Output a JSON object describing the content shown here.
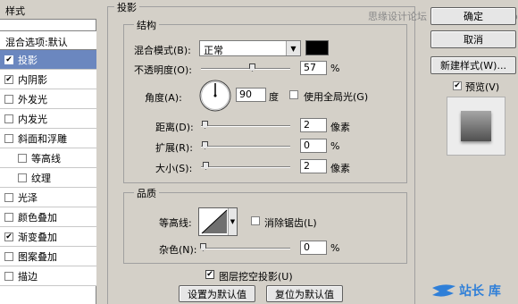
{
  "left_panel": {
    "header": "样式",
    "blend_options": "混合选项:默认",
    "items": [
      {
        "label": "投影",
        "checked": true,
        "selected": true,
        "sub": false
      },
      {
        "label": "内阴影",
        "checked": true,
        "selected": false,
        "sub": false
      },
      {
        "label": "外发光",
        "checked": false,
        "selected": false,
        "sub": false
      },
      {
        "label": "内发光",
        "checked": false,
        "selected": false,
        "sub": false
      },
      {
        "label": "斜面和浮雕",
        "checked": false,
        "selected": false,
        "sub": false
      },
      {
        "label": "等高线",
        "checked": false,
        "selected": false,
        "sub": true
      },
      {
        "label": "纹理",
        "checked": false,
        "selected": false,
        "sub": true
      },
      {
        "label": "光泽",
        "checked": false,
        "selected": false,
        "sub": false
      },
      {
        "label": "颜色叠加",
        "checked": false,
        "selected": false,
        "sub": false
      },
      {
        "label": "渐变叠加",
        "checked": true,
        "selected": false,
        "sub": false
      },
      {
        "label": "图案叠加",
        "checked": false,
        "selected": false,
        "sub": false
      },
      {
        "label": "描边",
        "checked": false,
        "selected": false,
        "sub": false
      }
    ]
  },
  "drop_shadow": {
    "title": "投影",
    "structure": {
      "title": "结构",
      "blend_mode_label": "混合模式(B):",
      "blend_mode_value": "正常",
      "blend_color": "#000000",
      "opacity_label": "不透明度(O):",
      "opacity_value": "57",
      "opacity_level": 0.57,
      "opacity_unit": "%",
      "angle_label": "角度(A):",
      "angle_value": "90",
      "angle_unit": "度",
      "global_light_label": "使用全局光(G)",
      "global_light_checked": false,
      "distance_label": "距离(D):",
      "distance_value": "2",
      "distance_unit": "像素",
      "spread_label": "扩展(R):",
      "spread_value": "0",
      "spread_unit": "%",
      "size_label": "大小(S):",
      "size_value": "2",
      "size_unit": "像素"
    },
    "quality": {
      "title": "品质",
      "contour_label": "等高线:",
      "anti_alias_label": "消除锯齿(L)",
      "anti_alias_checked": false,
      "noise_label": "杂色(N):",
      "noise_value": "0",
      "noise_unit": "%"
    },
    "knockout_label": "图层挖空投影(U)",
    "knockout_checked": true,
    "make_default_label": "设置为默认值",
    "reset_default_label": "复位为默认值"
  },
  "right_panel": {
    "ok_label": "确定",
    "cancel_label": "取消",
    "new_style_label": "新建样式(W)...",
    "preview_label": "预览(V)",
    "preview_checked": true
  },
  "watermarks": {
    "top": "思缘设计论坛 www.missyuan.com",
    "bottom": "站长 库"
  }
}
